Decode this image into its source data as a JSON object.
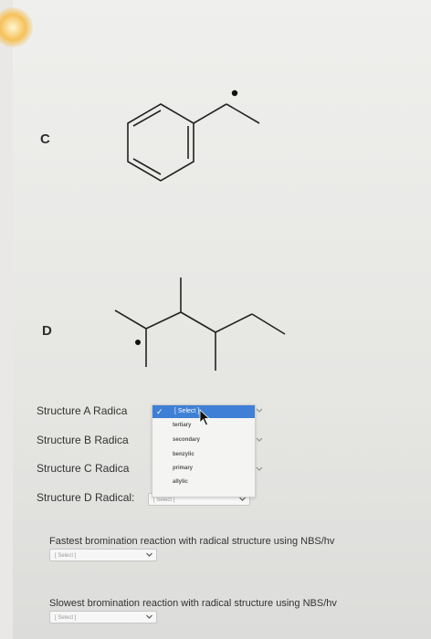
{
  "structures": {
    "c_label": "C",
    "d_label": "D"
  },
  "rows": [
    {
      "label": "Structure A Radica"
    },
    {
      "label": "Structure B Radica"
    },
    {
      "label": "Structure C Radica"
    },
    {
      "label": "Structure D Radical:",
      "value": "[ Select ]"
    }
  ],
  "dropdown_menu": {
    "selected": "[ Select ]",
    "options": [
      "tertiary",
      "secondary",
      "benzylic",
      "primary",
      "allylic"
    ]
  },
  "questions": {
    "fastest": {
      "text": "Fastest bromination reaction with radical structure using NBS/hv",
      "value": "[ Select ]"
    },
    "slowest": {
      "text": "Slowest bromination reaction with radical structure using NBS/hv",
      "value": "[ Select ]"
    }
  },
  "icons": {
    "check": "✓",
    "caret": "chevron-down-icon",
    "pointer": "mouse-pointer-icon"
  }
}
